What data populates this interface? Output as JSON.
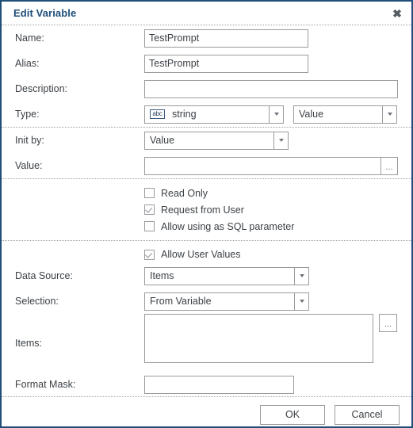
{
  "dialog": {
    "title": "Edit Variable",
    "close_icon": "close-icon",
    "accent_color": "#1f4e79",
    "border_color": "#9b9b9b",
    "text_color": "#3c4146"
  },
  "fields": {
    "name": {
      "label": "Name:",
      "value": "TestPrompt",
      "placeholder": ""
    },
    "alias": {
      "label": "Alias:",
      "value": "TestPrompt",
      "placeholder": ""
    },
    "description": {
      "label": "Description:",
      "value": "",
      "placeholder": ""
    },
    "type": {
      "label": "Type:",
      "icon": "abc-icon",
      "icon_text": "abc",
      "value": "string",
      "kind_value": "Value"
    },
    "init_by": {
      "label": "Init by:",
      "value": "Value"
    },
    "value": {
      "label": "Value:",
      "value": "",
      "placeholder": "",
      "ellipsis_label": "..."
    },
    "data_source": {
      "label": "Data Source:",
      "value": "Items"
    },
    "selection": {
      "label": "Selection:",
      "value": "From Variable"
    },
    "items": {
      "label": "Items:",
      "value": "",
      "placeholder": "",
      "ellipsis_label": "..."
    },
    "format_mask": {
      "label": "Format Mask:",
      "value": "",
      "placeholder": ""
    }
  },
  "checkboxes": [
    {
      "label": "Read Only",
      "checked": false
    },
    {
      "label": "Request from User",
      "checked": true
    },
    {
      "label": "Allow using as SQL parameter",
      "checked": false
    },
    {
      "label": "Allow User Values",
      "checked": true
    }
  ],
  "footer": {
    "ok_label": "OK",
    "cancel_label": "Cancel"
  }
}
